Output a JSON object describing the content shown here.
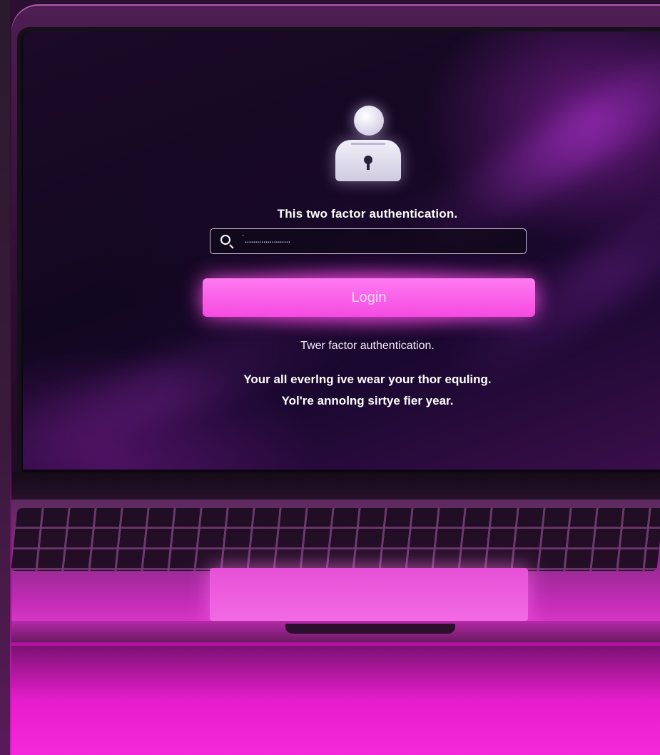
{
  "screen": {
    "heading": "This two factor authentication.",
    "input": {
      "value": "˙......................",
      "icon": "search-icon"
    },
    "login_button": {
      "label": "Login"
    },
    "subtitle": "Twer factor authentication.",
    "message_line_1": "Your all everlng ive wear your thor equling.",
    "message_line_2": "Yol're annolng sirtye fier year.",
    "user_icon": "user-lock-icon"
  },
  "colors": {
    "accent": "#f54be0",
    "screen_background": "#120720",
    "text": "#ffffff"
  }
}
